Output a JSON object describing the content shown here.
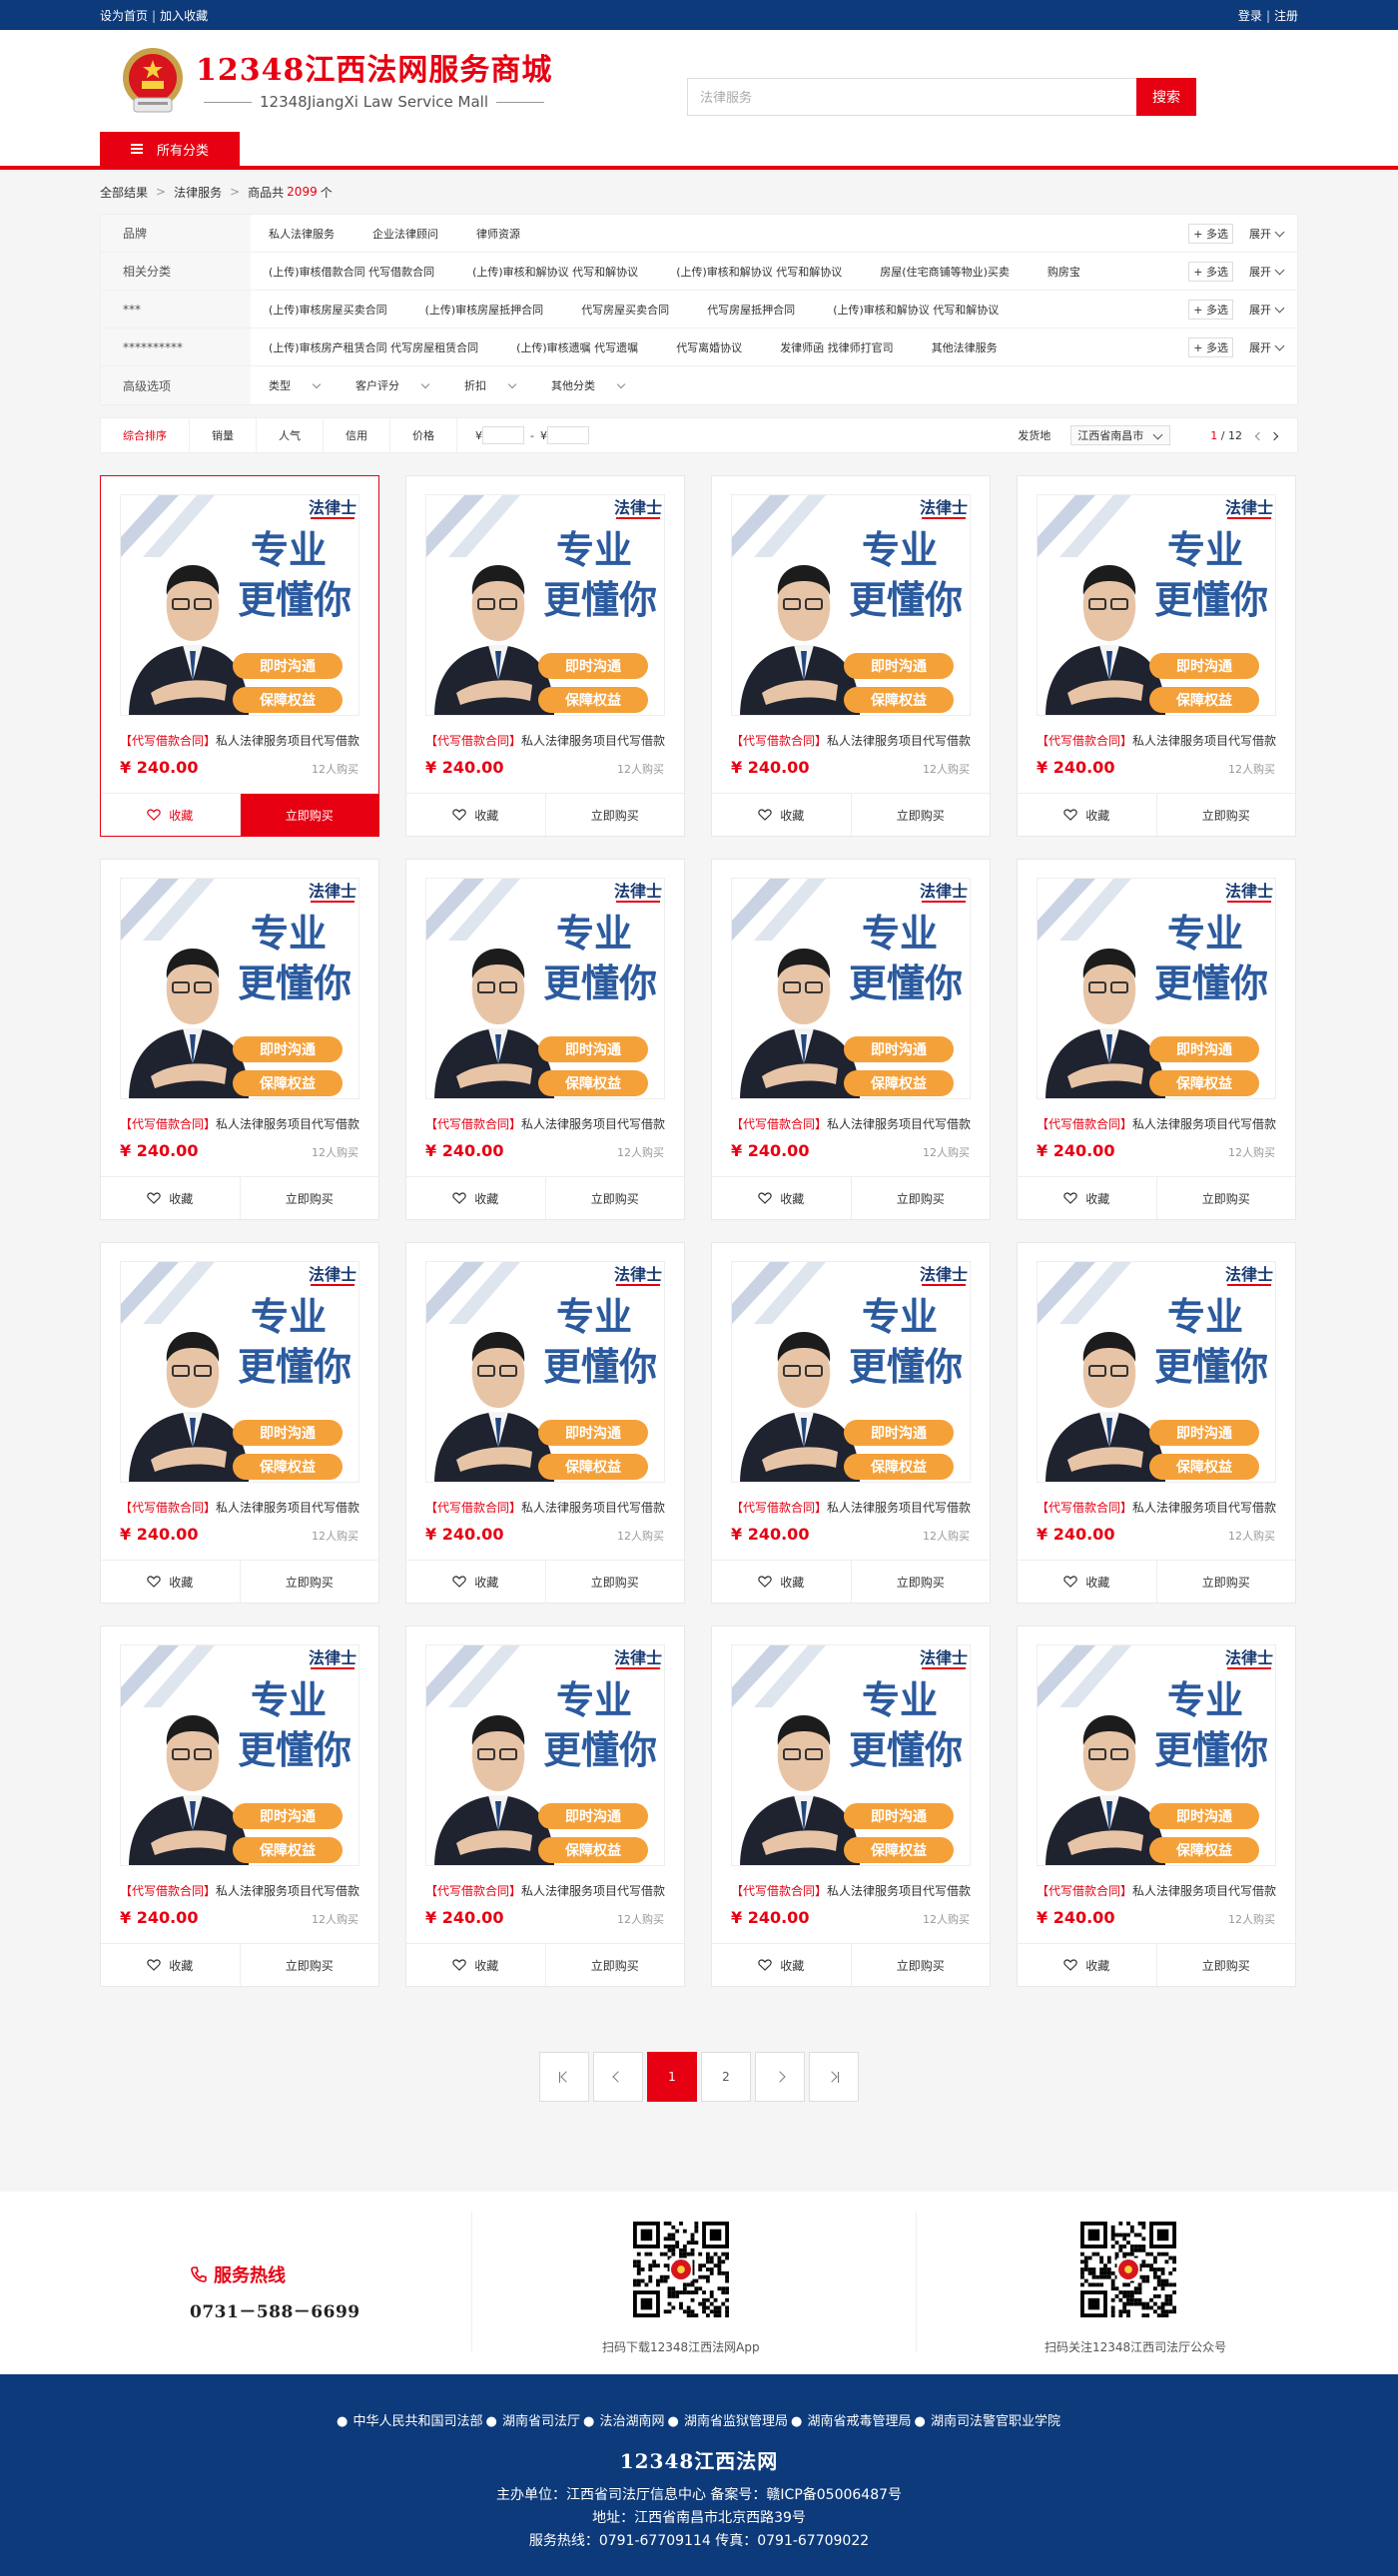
{
  "topbar": {
    "home": "设为首页",
    "fav": "加入收藏",
    "login": "登录",
    "register": "注册"
  },
  "header": {
    "title": "12348江西法网服务商城",
    "subtitle": "12348JiangXi Law Service Mall",
    "search_placeholder": "法律服务",
    "search_button": "搜索",
    "all_categories": "所有分类"
  },
  "breadcrumb": {
    "root": "全部结果",
    "current": "法律服务",
    "prefix": "商品共",
    "count": "2099",
    "suffix": "个"
  },
  "filters": {
    "rows": [
      {
        "label": "品牌",
        "items": [
          "私人法律服务",
          "企业法律顾问",
          "律师资源"
        ],
        "multi": "+ 多选",
        "expand": "展开"
      },
      {
        "label": "相关分类",
        "items": [
          "(上传)审核借款合同 代写借款合同",
          "(上传)审核和解协议 代写和解协议",
          "(上传)审核和解协议 代写和解协议",
          "房屋(住宅商铺等物业)买卖",
          "购房宝"
        ],
        "multi": "+ 多选",
        "expand": "展开"
      },
      {
        "label": "***",
        "items": [
          "(上传)审核房屋买卖合同",
          "(上传)审核房屋抵押合同",
          "代写房屋买卖合同",
          "代写房屋抵押合同",
          "(上传)审核和解协议 代写和解协议"
        ],
        "multi": "+ 多选",
        "expand": "展开"
      },
      {
        "label": "**********",
        "items": [
          "(上传)审核房产租赁合同 代写房屋租赁合同",
          "(上传)审核遗嘱 代写遗嘱",
          "代写离婚协议",
          "发律师函 找律师打官司",
          "其他法律服务"
        ],
        "multi": "+ 多选",
        "expand": "展开"
      }
    ],
    "advanced": {
      "label": "高级选项",
      "items": [
        "类型",
        "客户评分",
        "折扣",
        "其他分类"
      ]
    }
  },
  "sortbar": {
    "items": [
      "综合排序",
      "销量",
      "人气",
      "信用",
      "价格"
    ],
    "price_sym": "¥",
    "price_sep": "-",
    "location_label": "发货地",
    "location": "江西省南昌市",
    "page_cur": "1",
    "page_total": "/ 12"
  },
  "product": {
    "tag": "【代写借款合同】",
    "name": "私人法律服务项目代写借款合同",
    "price": "¥ 240.00",
    "sold": "12人购买",
    "fav": "收藏",
    "buy": "立即购买",
    "img_brand": "法律士",
    "img_line1": "专业",
    "img_line2": "更懂你",
    "img_btn1": "即时沟通",
    "img_btn2": "保障权益"
  },
  "pagination": {
    "pages": [
      "1",
      "2"
    ]
  },
  "service": {
    "hotline_title": "服务热线",
    "hotline": "0731－588－6699",
    "qr1_caption": "扫码下载12348江西法网App",
    "qr2_caption": "扫码关注12348江西司法厅公众号"
  },
  "footer": {
    "links": [
      "中华人民共和国司法部",
      "湖南省司法厅",
      "法治湖南网",
      "湖南省监狱管理局",
      "湖南省戒毒管理局",
      "湖南司法警官职业学院"
    ],
    "title": "12348江西法网",
    "line1": "主办单位：江西省司法厅信息中心  备案号：赣ICP备05006487号",
    "line2": "地址：江西省南昌市北京西路39号",
    "line3": "服务热线：0791-67709114   传真：0791-67709022"
  },
  "colors": {
    "brand_red": "#e60012",
    "navy": "#0d3a7a"
  }
}
